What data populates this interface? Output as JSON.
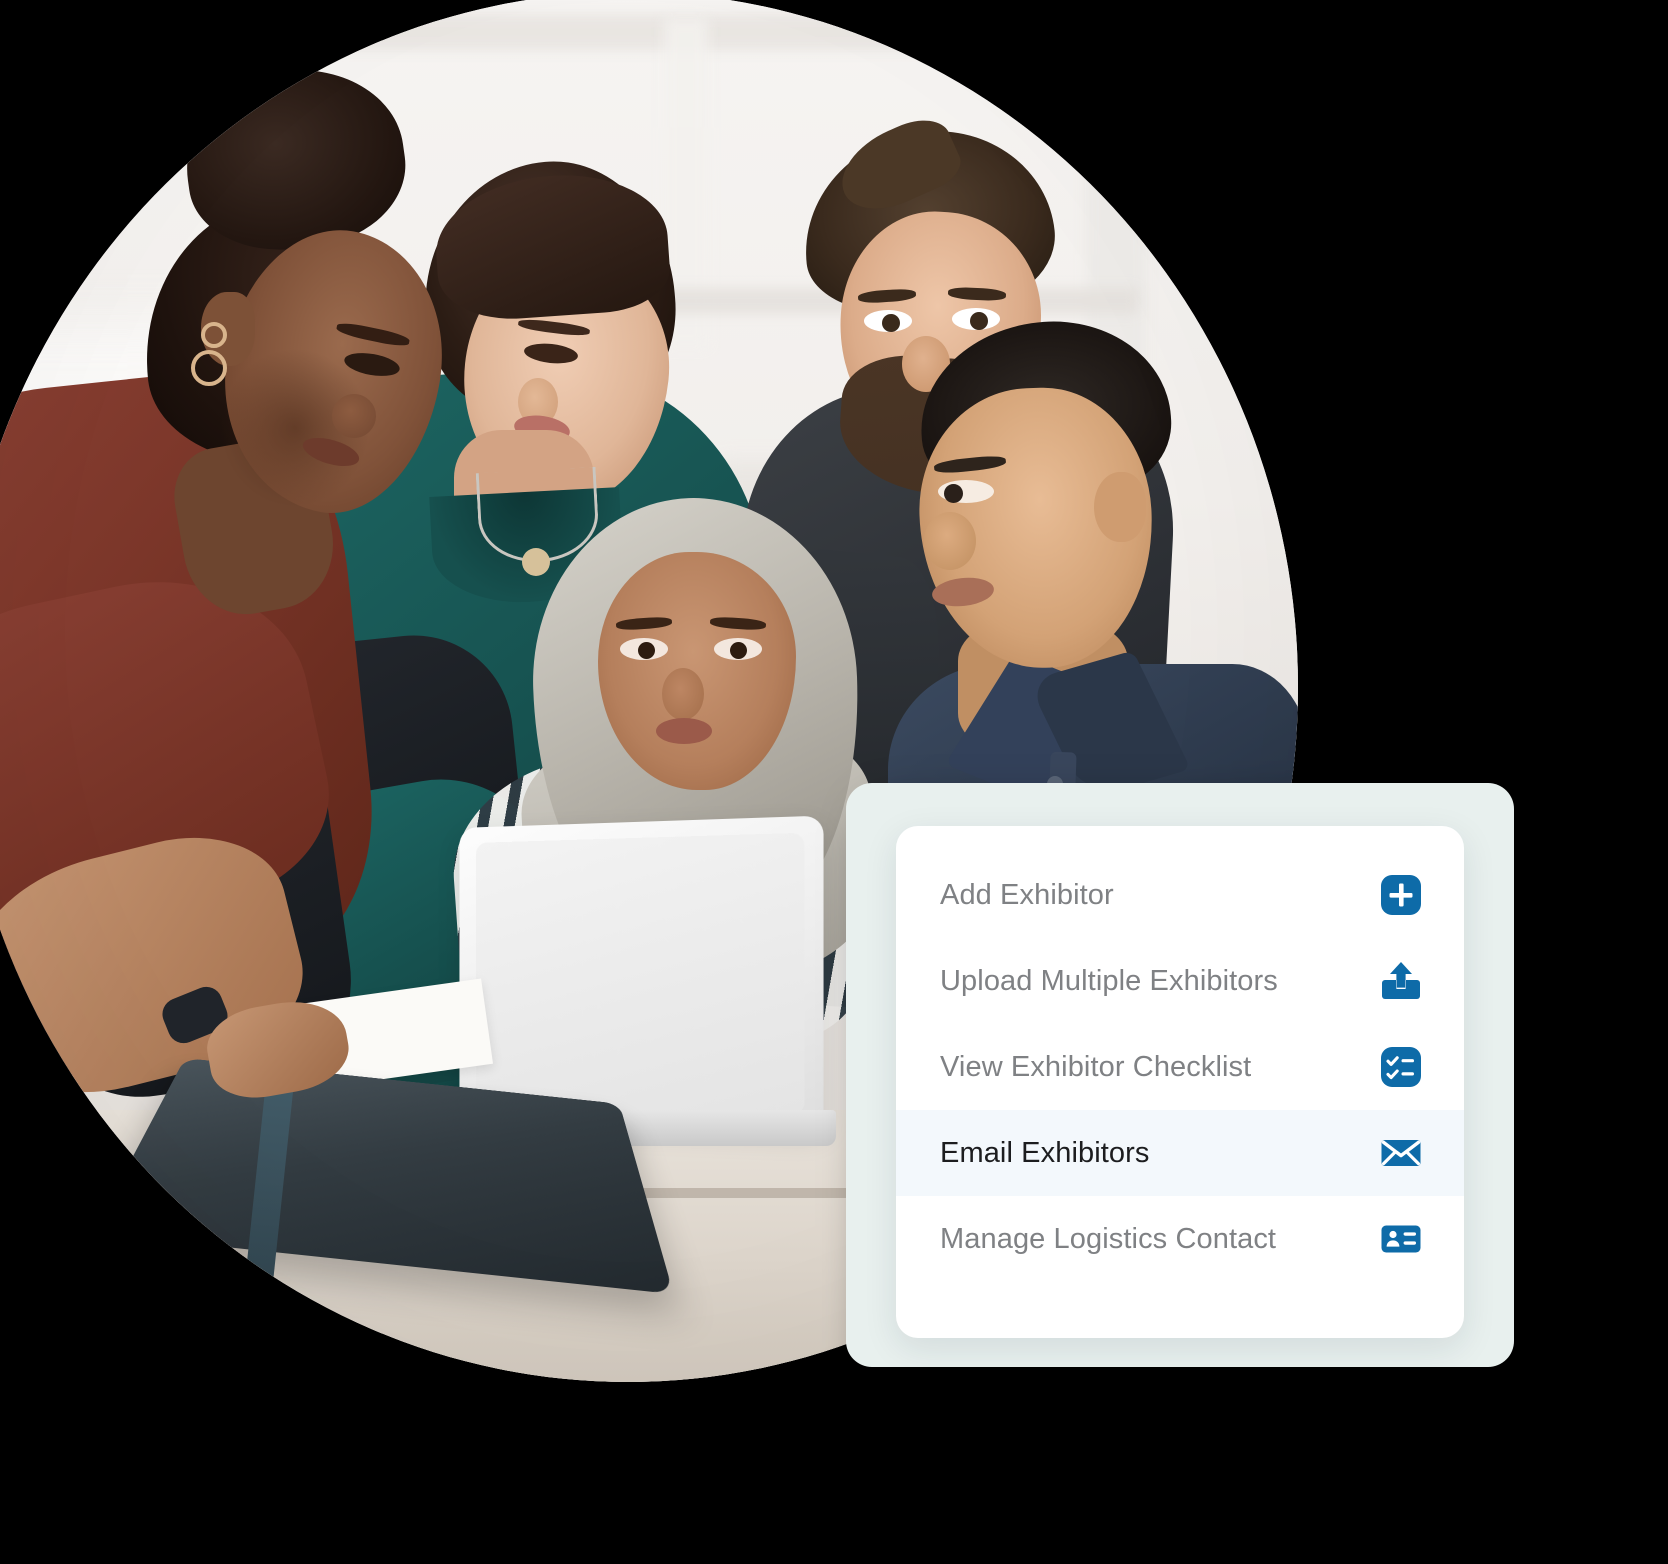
{
  "accent_color": "#0e6ba8",
  "panel_bg_color": "#e8f0ee",
  "card_bg_color": "#ffffff",
  "active_row_bg_color": "#f3f8fc",
  "label_color": "#7f8184",
  "active_label_color": "#1c1d1f",
  "photo": {
    "alt_description": "Five colleagues gathered around a laptop in an office, masked into a circle",
    "people_count": 5
  },
  "menu": {
    "items": [
      {
        "label": "Add Exhibitor",
        "icon": "plus-square-icon",
        "active": false
      },
      {
        "label": "Upload Multiple Exhibitors",
        "icon": "upload-icon",
        "active": false
      },
      {
        "label": "View Exhibitor Checklist",
        "icon": "checklist-icon",
        "active": false
      },
      {
        "label": "Email Exhibitors",
        "icon": "envelope-icon",
        "active": true
      },
      {
        "label": "Manage Logistics Contact",
        "icon": "contact-card-icon",
        "active": false
      }
    ]
  }
}
